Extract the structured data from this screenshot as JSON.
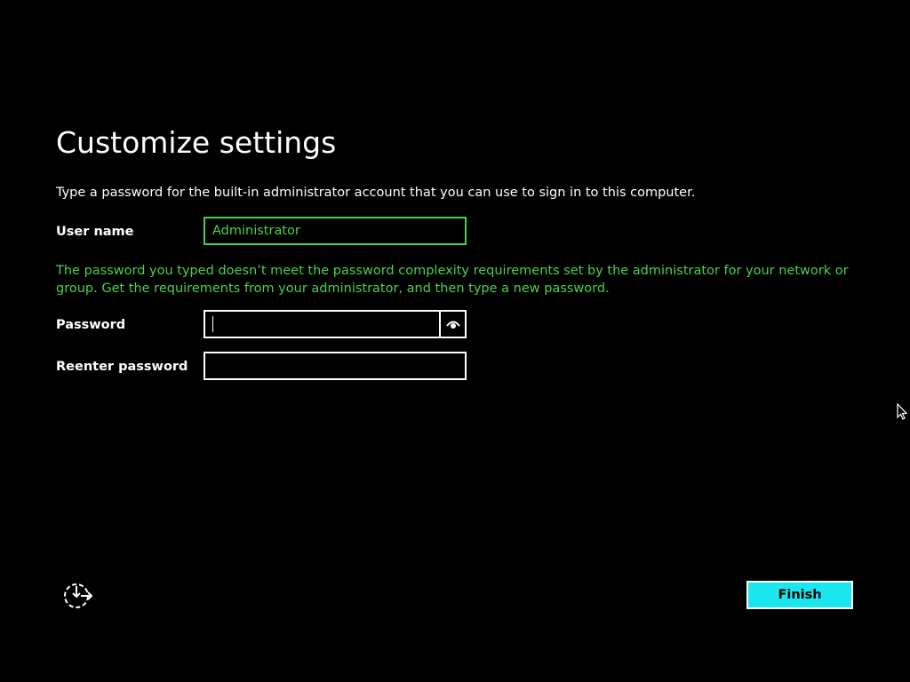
{
  "page": {
    "title": "Customize settings",
    "instructions": "Type a password for the built-in administrator account that you can use to sign in to this computer."
  },
  "form": {
    "username_label": "User name",
    "username_value": "Administrator",
    "error_message": "The password you typed doesn’t meet the password complexity requirements set by the administrator for your network or group. Get the requirements from your administrator, and then type a new password.",
    "password_label": "Password",
    "password_value": "",
    "reenter_label": "Reenter password",
    "reenter_value": ""
  },
  "footer": {
    "finish_label": "Finish"
  },
  "icons": {
    "reveal": "eye-icon",
    "accessibility": "ease-of-access-icon",
    "cursor": "mouse-pointer-icon"
  },
  "colors": {
    "background": "#000000",
    "text": "#ffffff",
    "valid_accent": "#4cd04c",
    "finish_button": "#1ae6f0"
  }
}
